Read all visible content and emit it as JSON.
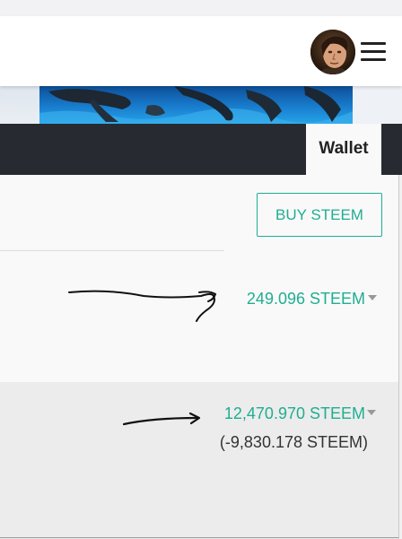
{
  "header": {
    "avatar": "user-avatar",
    "menu_icon": "hamburger-menu-icon"
  },
  "cover": {
    "image": "dolphins-cover-photo"
  },
  "tabs": {
    "wallet_label": "Wallet"
  },
  "actions": {
    "buy_steem_label": "BUY STEEM"
  },
  "balances": {
    "steem": "249.096 STEEM",
    "steem_power": "12,470.970 STEEM",
    "steem_power_delegated": "(-9,830.178 STEEM)"
  },
  "colors": {
    "accent": "#1fae91",
    "tabbar": "#272b31",
    "annotation_ink": "#111111"
  }
}
